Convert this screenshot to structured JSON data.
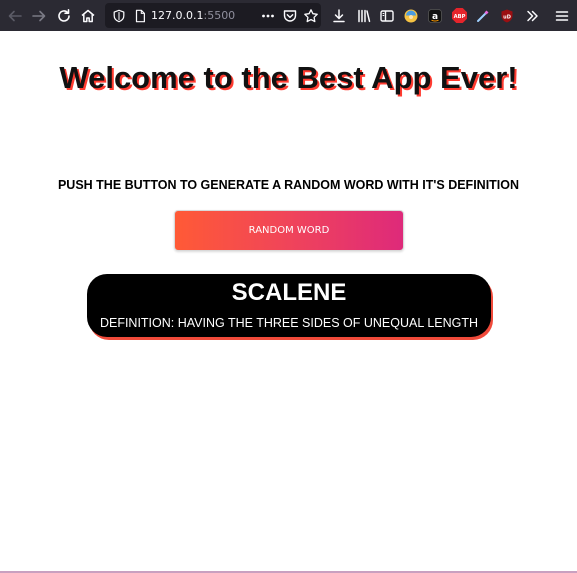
{
  "browser": {
    "url_host": "127.0.0.1",
    "url_port": ":5500",
    "icons": [
      "back-arrow-icon",
      "forward-arrow-icon",
      "reload-icon",
      "home-icon",
      "tracking-shield-icon",
      "page-icon",
      "more-actions-icon",
      "pocket-icon",
      "bookmark-star-icon",
      "downloads-icon",
      "library-icon",
      "sidebar-icon",
      "profile-avatar-icon",
      "amazon-extension-icon",
      "adblock-plus-icon",
      "eyedropper-icon",
      "ublock-origin-icon",
      "overflow-chevron-icon",
      "hamburger-menu-icon"
    ],
    "adblock_label": "ABP",
    "ublock_label": "uD"
  },
  "page": {
    "title": "Welcome to the Best App Ever!",
    "instruction": "PUSH THE BUTTON TO GENERATE A RANDOM WORD WITH IT'S DEFINITION",
    "button_label": "RANDOM WORD",
    "word": "SCALENE",
    "definition": "DEFINITION: HAVING THE THREE SIDES OF UNEQUAL LENGTH"
  },
  "colors": {
    "toolbar_bg": "#2b2a33",
    "title_shadow": "#ff3b30",
    "button_gradient_start": "#ff5a36",
    "button_gradient_end": "#de2a7a",
    "card_bg": "#000000",
    "card_shadow": "#f04a3a"
  }
}
